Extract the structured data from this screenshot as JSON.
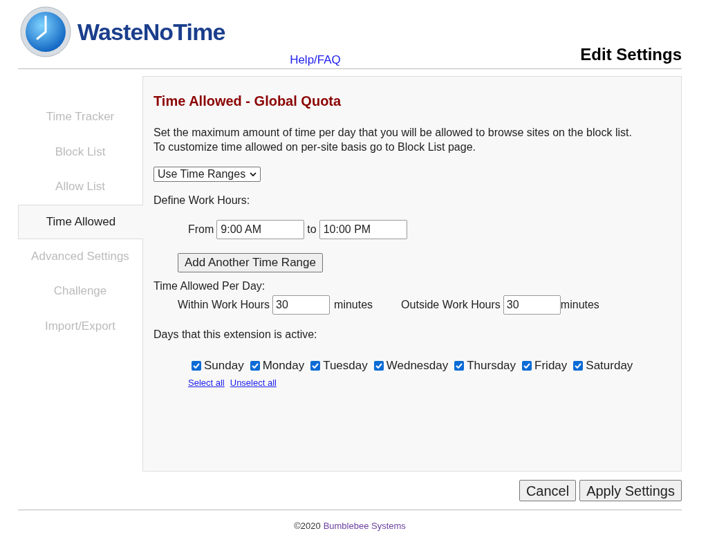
{
  "header": {
    "app_name": "WasteNoTime",
    "help_link": "Help/FAQ",
    "page_title": "Edit Settings"
  },
  "sidebar": {
    "items": [
      {
        "label": "Time Tracker",
        "selected": false
      },
      {
        "label": "Block List",
        "selected": false
      },
      {
        "label": "Allow List",
        "selected": false
      },
      {
        "label": "Time Allowed",
        "selected": true
      },
      {
        "label": "Advanced Settings",
        "selected": false
      },
      {
        "label": "Challenge",
        "selected": false
      },
      {
        "label": "Import/Export",
        "selected": false
      }
    ]
  },
  "panel": {
    "title": "Time Allowed - Global Quota",
    "description": [
      "Set the maximum amount of time per day that you will be allowed to browse sites on the block list.",
      "To customize time allowed on per-site basis go to Block List page."
    ],
    "mode_select": {
      "value": "Use Time Ranges"
    },
    "work_hours_label": "Define Work Hours:",
    "time_range": {
      "from_label": "From",
      "from_value": "9:00 AM",
      "to_label": "to",
      "to_value": "10:00 PM"
    },
    "add_range_button": "Add Another Time Range",
    "per_day_label": "Time Allowed Per Day:",
    "per_day": [
      {
        "label": "Within Work Hours",
        "value": "30",
        "unit": "minutes"
      },
      {
        "label": "Outside Work Hours",
        "value": "30",
        "unit": "minutes"
      }
    ],
    "days_label": "Days that this extension is active:",
    "days": [
      {
        "label": "Sunday",
        "checked": true
      },
      {
        "label": "Monday",
        "checked": true
      },
      {
        "label": "Tuesday",
        "checked": true
      },
      {
        "label": "Wednesday",
        "checked": true
      },
      {
        "label": "Thursday",
        "checked": true
      },
      {
        "label": "Friday",
        "checked": true
      },
      {
        "label": "Saturday",
        "checked": true
      }
    ],
    "select_all": "Select all",
    "unselect_all": "Unselect all"
  },
  "buttons": [
    "Cancel",
    "Apply Settings"
  ],
  "footer": {
    "copyright": "©2020",
    "link": "Bumblebee Systems"
  }
}
